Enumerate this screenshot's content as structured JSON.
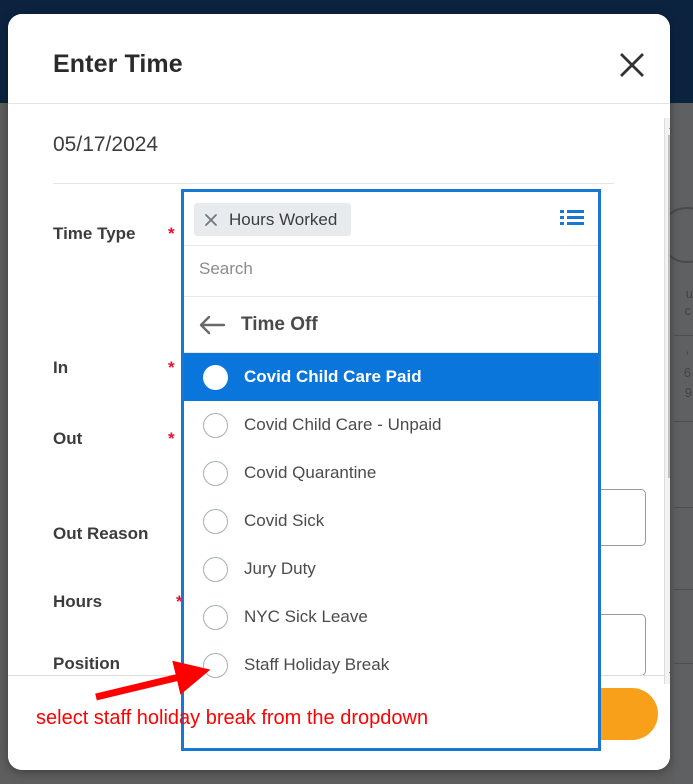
{
  "modal": {
    "title": "Enter Time",
    "close_icon": "close-icon",
    "date": "05/17/2024"
  },
  "form": {
    "fields": [
      {
        "label": "Time Type",
        "required": true
      },
      {
        "label": "In",
        "required": true
      },
      {
        "label": "Out",
        "required": true
      },
      {
        "label": "Out Reason",
        "required": false
      },
      {
        "label": "Hours",
        "required": true
      },
      {
        "label": "Position",
        "required": false
      }
    ],
    "required_marker": "*"
  },
  "dropdown": {
    "selected_pill": {
      "label": "Hours Worked",
      "remove_icon": "close-icon"
    },
    "list_icon": "list-view-icon",
    "search": {
      "placeholder": "Search",
      "value": ""
    },
    "back": {
      "label": "Time Off",
      "icon": "arrow-left-icon"
    },
    "options": [
      {
        "label": "Covid Child Care Paid",
        "selected": true
      },
      {
        "label": "Covid Child Care - Unpaid",
        "selected": false
      },
      {
        "label": "Covid Quarantine",
        "selected": false
      },
      {
        "label": "Covid Sick",
        "selected": false
      },
      {
        "label": "Jury Duty",
        "selected": false
      },
      {
        "label": "NYC Sick Leave",
        "selected": false
      },
      {
        "label": "Staff Holiday Break",
        "selected": false
      }
    ]
  },
  "scrollbar": {
    "up_icon": "caret-up-icon",
    "down_icon": "caret-down-icon"
  },
  "annotation": {
    "text": "select staff holiday break from the dropdown",
    "color": "#ff0000",
    "arrow": "red-arrow-icon"
  },
  "colors": {
    "accent_blue": "#1877d2",
    "selected_blue": "#0a76dc",
    "header_navy": "#0c2340",
    "ok_orange": "#f9a01b",
    "required_red": "#e8112d"
  }
}
